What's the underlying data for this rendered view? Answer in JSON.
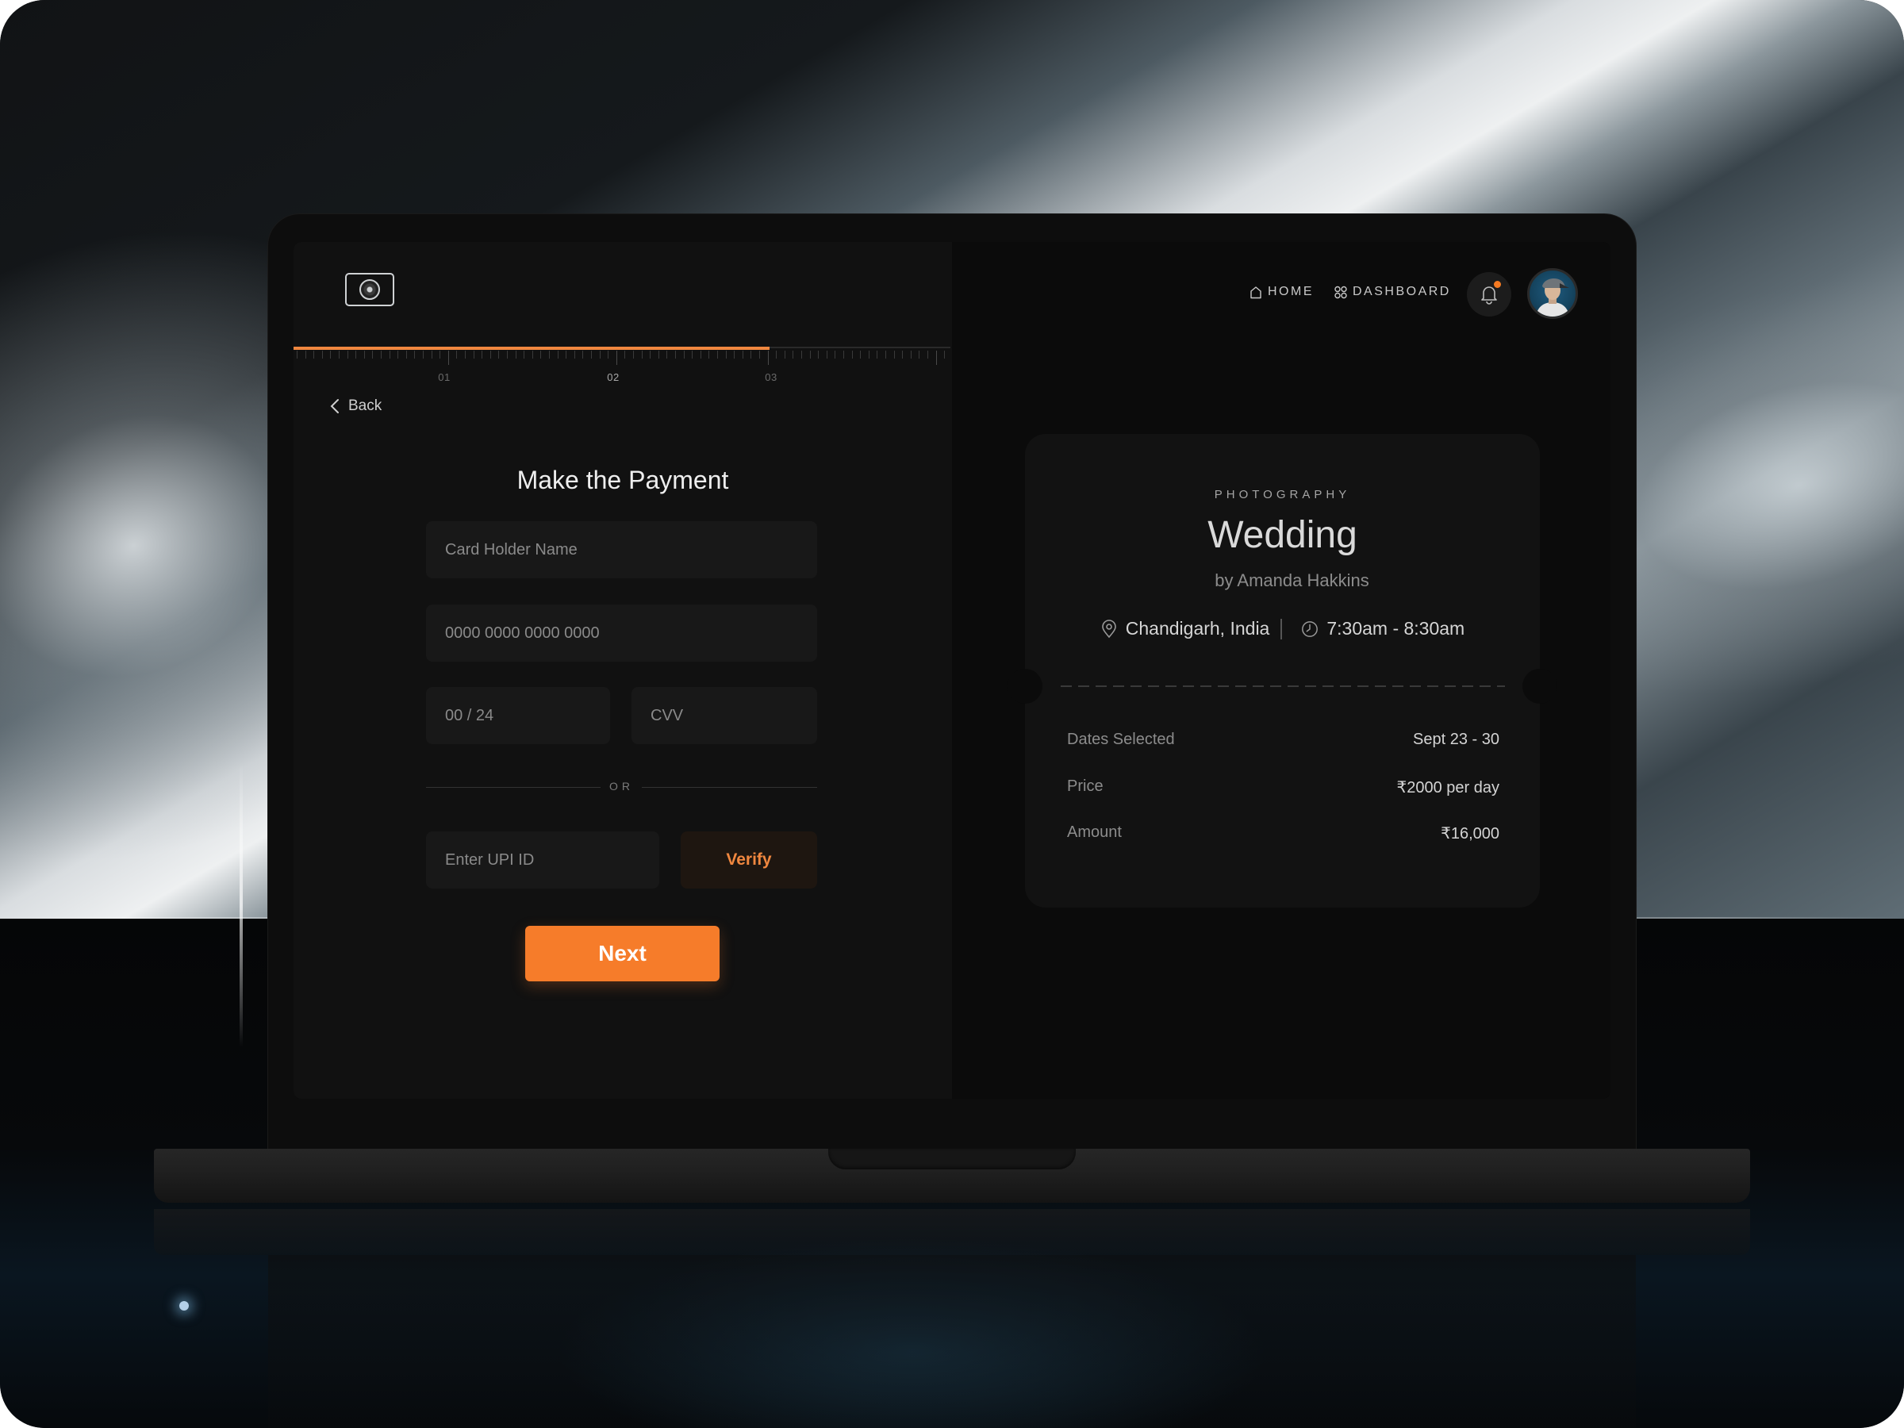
{
  "header": {
    "logo": "camera-logo",
    "nav": [
      {
        "label": "HOME",
        "icon": "home-icon"
      },
      {
        "label": "DASHBOARD",
        "icon": "grid-icon"
      }
    ],
    "notifications": {
      "icon": "bell-icon",
      "has_unread": true
    },
    "avatar": "user-avatar"
  },
  "progress": {
    "steps": [
      "01",
      "02",
      "03"
    ],
    "current_step": 3,
    "fraction_complete": 0.725
  },
  "back_label": "Back",
  "form": {
    "title": "Make the Payment",
    "card_holder_placeholder": "Card Holder Name",
    "card_number_placeholder": "0000 0000 0000 0000",
    "expiry_placeholder": "00 / 24",
    "cvv_placeholder": "CVV",
    "divider_text": "OR",
    "upi_placeholder": "Enter UPI ID",
    "verify_label": "Verify",
    "next_label": "Next"
  },
  "summary": {
    "category": "PHOTOGRAPHY",
    "title": "Wedding",
    "author": "by Amanda Hakkins",
    "location": "Chandigarh, India",
    "time": "7:30am - 8:30am",
    "rows": [
      {
        "label": "Dates Selected",
        "value": "Sept 23 - 30"
      },
      {
        "label": "Price",
        "value": "₹2000 per day"
      },
      {
        "label": "Amount",
        "value": "₹16,000"
      }
    ]
  },
  "colors": {
    "accent": "#f67c2a",
    "verify_text": "#f0873f",
    "panel_left": "#111111",
    "panel_right": "#0b0b0b",
    "card": "#121212"
  }
}
